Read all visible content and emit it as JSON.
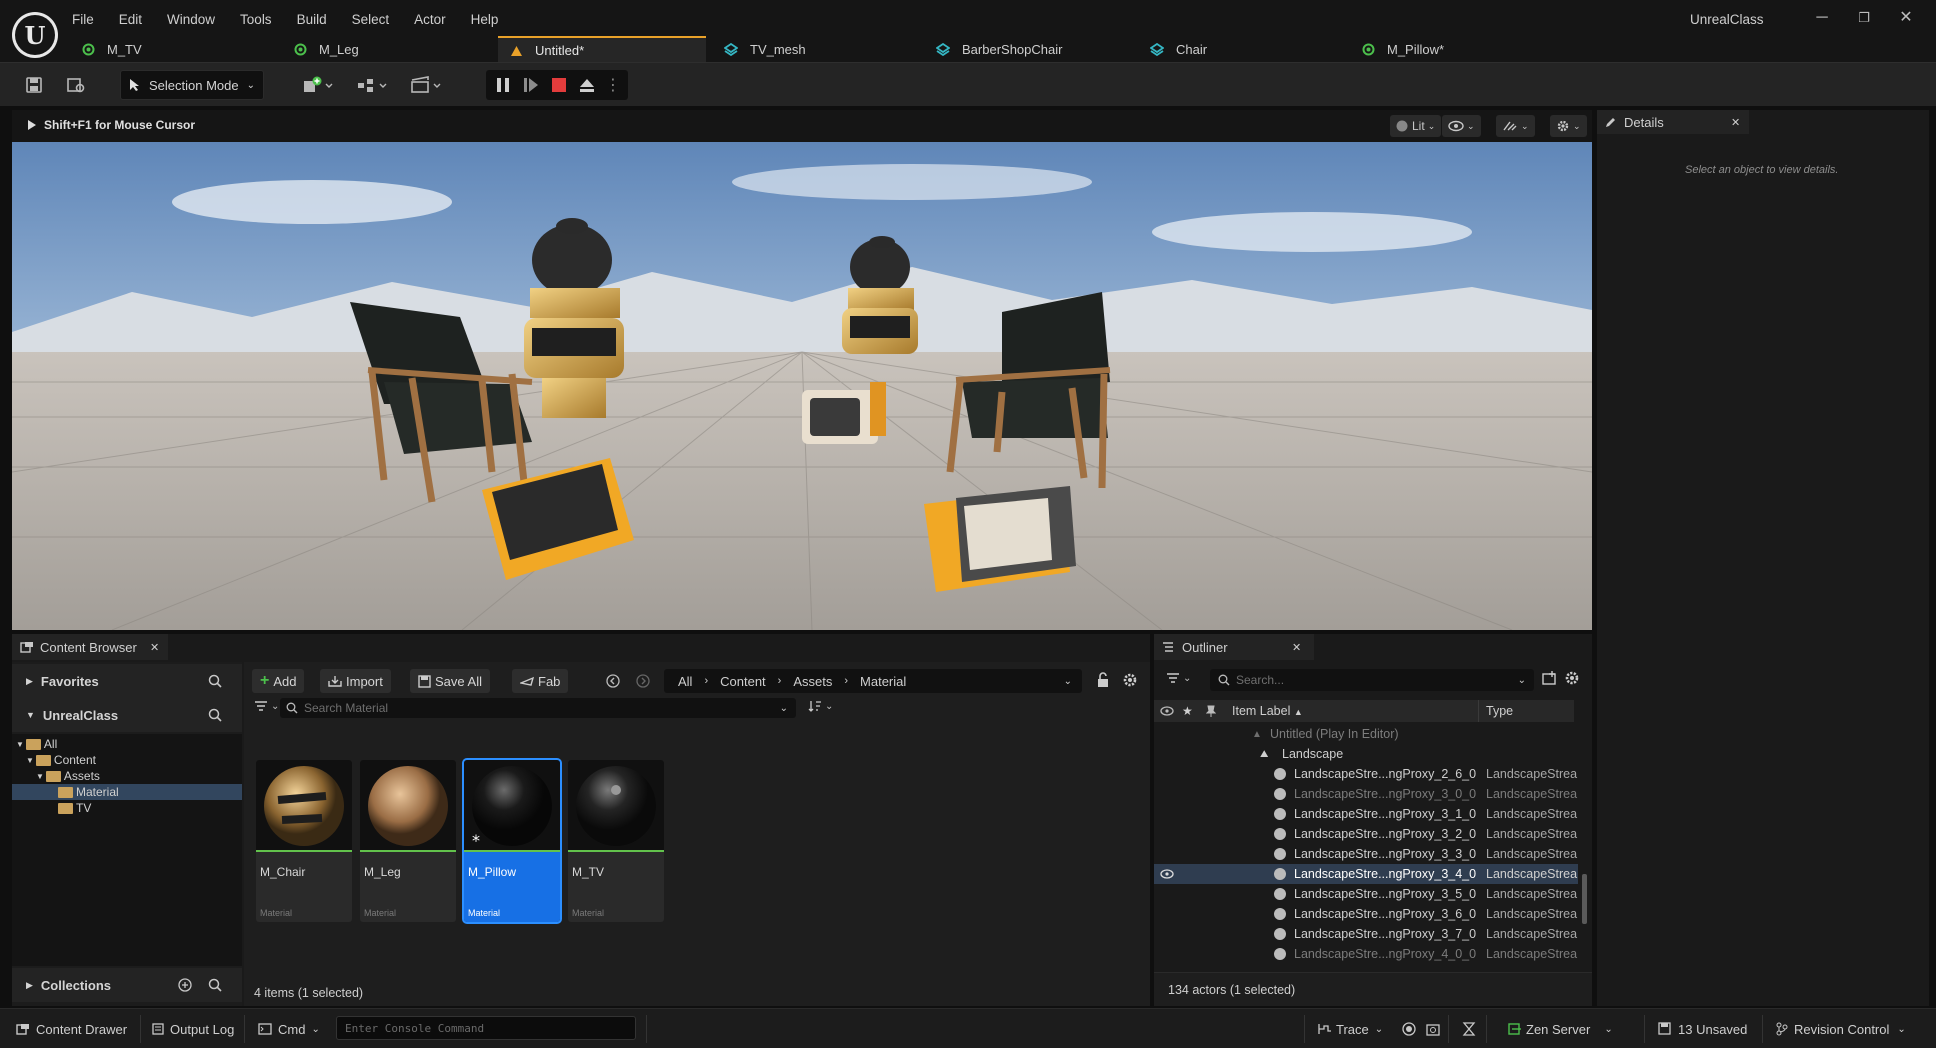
{
  "app": {
    "title": "UnrealClass"
  },
  "menu": [
    "File",
    "Edit",
    "Window",
    "Tools",
    "Build",
    "Select",
    "Actor",
    "Help"
  ],
  "tabs": [
    "M_TV",
    "M_Leg",
    "Untitled*",
    "TV_mesh",
    "BarberShopChair",
    "Chair",
    "M_Pillow*"
  ],
  "toolbar": {
    "selection_mode": "Selection Mode"
  },
  "viewport": {
    "hint": "Shift+F1 for Mouse Cursor",
    "view_mode": "Lit"
  },
  "details": {
    "tab": "Details",
    "empty_message": "Select an object to view details."
  },
  "content_browser": {
    "tab": "Content Browser",
    "favorites": "Favorites",
    "project": "UnrealClass",
    "collections": "Collections",
    "tree": [
      "All",
      "Content",
      "Assets",
      "Material",
      "TV"
    ],
    "buttons": {
      "add": "Add",
      "import": "Import",
      "save_all": "Save All",
      "fab": "Fab"
    },
    "path": [
      "All",
      "Content",
      "Assets",
      "Material"
    ],
    "search_placeholder": "Search Material",
    "assets": [
      {
        "name": "M_Chair",
        "type": "Material"
      },
      {
        "name": "M_Leg",
        "type": "Material"
      },
      {
        "name": "M_Pillow",
        "type": "Material"
      },
      {
        "name": "M_TV",
        "type": "Material"
      }
    ],
    "status": "4 items (1 selected)"
  },
  "outliner": {
    "tab": "Outliner",
    "search_placeholder": "Search...",
    "col_label": "Item Label",
    "col_type": "Type",
    "world": "Untitled (Play In Editor)",
    "landscape": "Landscape",
    "rows": [
      {
        "label": "LandscapeStre...ngProxy_2_6_0",
        "type": "LandscapeStrea",
        "dim": false
      },
      {
        "label": "LandscapeStre...ngProxy_3_0_0",
        "type": "LandscapeStrea",
        "dim": true
      },
      {
        "label": "LandscapeStre...ngProxy_3_1_0",
        "type": "LandscapeStrea",
        "dim": false
      },
      {
        "label": "LandscapeStre...ngProxy_3_2_0",
        "type": "LandscapeStrea",
        "dim": false
      },
      {
        "label": "LandscapeStre...ngProxy_3_3_0",
        "type": "LandscapeStrea",
        "dim": false
      },
      {
        "label": "LandscapeStre...ngProxy_3_4_0",
        "type": "LandscapeStrea",
        "dim": false,
        "selected": true
      },
      {
        "label": "LandscapeStre...ngProxy_3_5_0",
        "type": "LandscapeStrea",
        "dim": false
      },
      {
        "label": "LandscapeStre...ngProxy_3_6_0",
        "type": "LandscapeStrea",
        "dim": false
      },
      {
        "label": "LandscapeStre...ngProxy_3_7_0",
        "type": "LandscapeStrea",
        "dim": false
      },
      {
        "label": "LandscapeStre...ngProxy_4_0_0",
        "type": "LandscapeStrea",
        "dim": true
      }
    ],
    "status": "134 actors (1 selected)"
  },
  "statusbar": {
    "content_drawer": "Content Drawer",
    "output_log": "Output Log",
    "cmd": "Cmd",
    "console_placeholder": "Enter Console Command",
    "trace": "Trace",
    "zen": "Zen Server",
    "unsaved": "13 Unsaved",
    "revision": "Revision Control"
  },
  "colors": {
    "accent_tab": "#e9a129",
    "selection": "#1770e5",
    "asset_bar": "#62c24c"
  }
}
